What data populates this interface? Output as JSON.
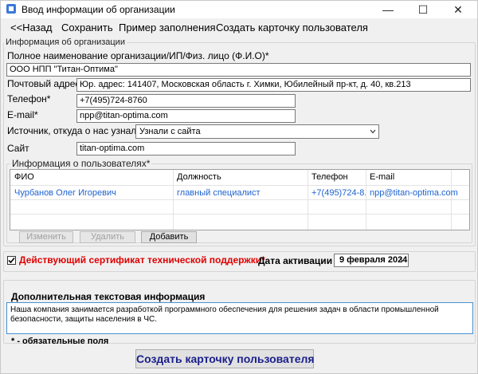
{
  "window": {
    "title": "Ввод информации об  организации",
    "controls": {
      "minimize": "—",
      "maximize": "☐",
      "close": "✕"
    }
  },
  "menu": {
    "back": "<<Назад",
    "save": "Сохранить",
    "example": "Пример заполнения",
    "create_card": "Создать карточку пользователя"
  },
  "org_group": {
    "label": "Информация об  организации"
  },
  "fields": {
    "full_name_label": "Полное наименование организации/ИП/Физ. лицо (Ф.И.О)*",
    "full_name_value": "ООО НПП \"Титан-Оптима\"",
    "address_label": "Почтовый адрес*",
    "address_value": "Юр. адрес: 141407, Московская область г. Химки, Юбилейный пр-кт, д. 40, кв.213",
    "phone_label": "Телефон*",
    "phone_value": "+7(495)724-8760",
    "email_label": "E-mail*",
    "email_value": "npp@titan-optima.com",
    "source_label": "Источник, откуда о нас узнали*",
    "source_value": "Узнали с сайта",
    "site_label": "Сайт",
    "site_value": "titan-optima.com"
  },
  "users_group": {
    "label": "Информация о пользователях*",
    "columns": [
      "ФИО",
      "Должность",
      "Телефон",
      "E-mail"
    ],
    "rows": [
      [
        "Чурбанов Олег Игоревич",
        "главный специалист",
        "+7(495)724-8...",
        "npp@titan-optima.com"
      ]
    ],
    "buttons": {
      "edit": "Изменить",
      "delete": "Удалить",
      "add": "Добавить"
    }
  },
  "certificate": {
    "label": "Действующий сертификат технической поддержки*",
    "checked": true,
    "activation_label": "Дата активации",
    "activation_date": "9 февраля  2024"
  },
  "extra": {
    "label": "Дополнительная текстовая информация",
    "text": "Наша компания занимается разработкой программного обеспечения для решения задач в области промышленной безопасности, защиты населения в ЧС."
  },
  "required_note": "* - обязательные поля",
  "create_button": "Создать карточку пользователя",
  "colors": {
    "cert_red": "#e00000",
    "link_blue": "#1e62d0",
    "button_text": "#1a1f8a"
  }
}
